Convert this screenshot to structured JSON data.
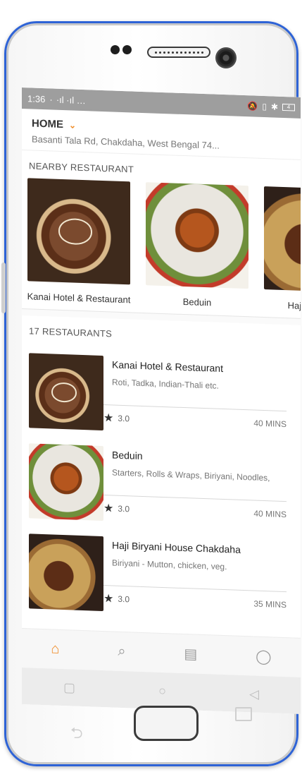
{
  "status": {
    "time": "1:36",
    "signal": "·  ·ıl ·ıl …",
    "battery": "4"
  },
  "location": {
    "title": "HOME",
    "address": "Basanti Tala Rd, Chakdaha, West Bengal 74..."
  },
  "nearby": {
    "heading": "NEARBY RESTAURANT",
    "items": [
      {
        "name": "Kanai Hotel & Restaurant"
      },
      {
        "name": "Beduin"
      },
      {
        "name": "Haji Biryani H"
      }
    ]
  },
  "restaurants": {
    "heading": "17 RESTAURANTS",
    "items": [
      {
        "name": "Kanai Hotel & Restaurant",
        "cuisine": "Roti, Tadka, Indian-Thali etc.",
        "rating": "3.0",
        "time": "40 MINS"
      },
      {
        "name": "Beduin",
        "cuisine": "Starters, Rolls & Wraps, Biriyani, Noodles,",
        "rating": "3.0",
        "time": "40 MINS"
      },
      {
        "name": "Haji Biryani House Chakdaha",
        "cuisine": "Biriyani - Mutton, chicken, veg.",
        "rating": "3.0",
        "time": "35 MINS"
      }
    ]
  },
  "colors": {
    "accent": "#f08a24",
    "frame": "#2e63d6"
  },
  "icons": {
    "home": "home-icon",
    "search": "search-icon",
    "orders": "receipt-icon",
    "profile": "user-icon"
  }
}
